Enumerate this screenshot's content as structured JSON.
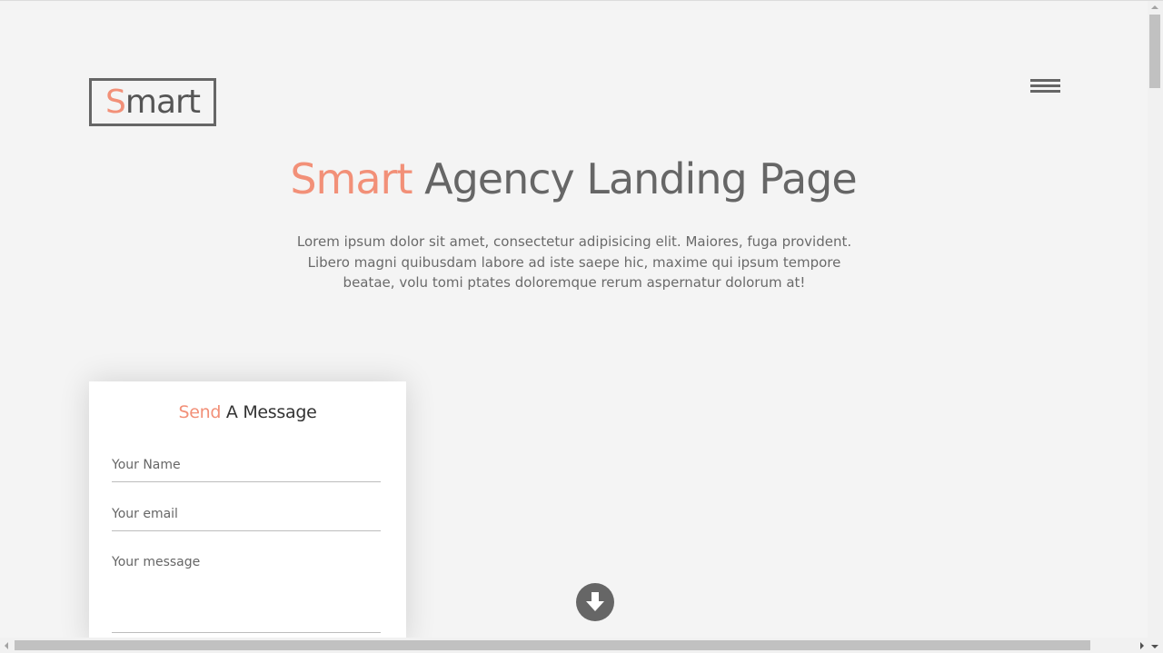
{
  "logo": {
    "accent": "S",
    "rest": "mart"
  },
  "menu": {
    "icon": "hamburger-menu-icon"
  },
  "hero": {
    "title_accent": "Smart",
    "title_rest": "Agency Landing Page",
    "description": "Lorem ipsum dolor sit amet, consectetur adipisicing elit. Maiores, fuga provident. Libero magni quibusdam labore ad iste saepe hic, maxime qui ipsum tempore beatae, volu tomi ptates doloremque rerum aspernatur dolorum at!"
  },
  "contact_form": {
    "title_accent": "Send",
    "title_rest": "A Message",
    "name_placeholder": "Your Name",
    "email_placeholder": "Your email",
    "message_placeholder": "Your message"
  },
  "scroll_down": {
    "icon": "arrow-down-circle-icon"
  },
  "colors": {
    "accent": "#f29078",
    "text": "#666666",
    "background": "#f4f4f4"
  }
}
